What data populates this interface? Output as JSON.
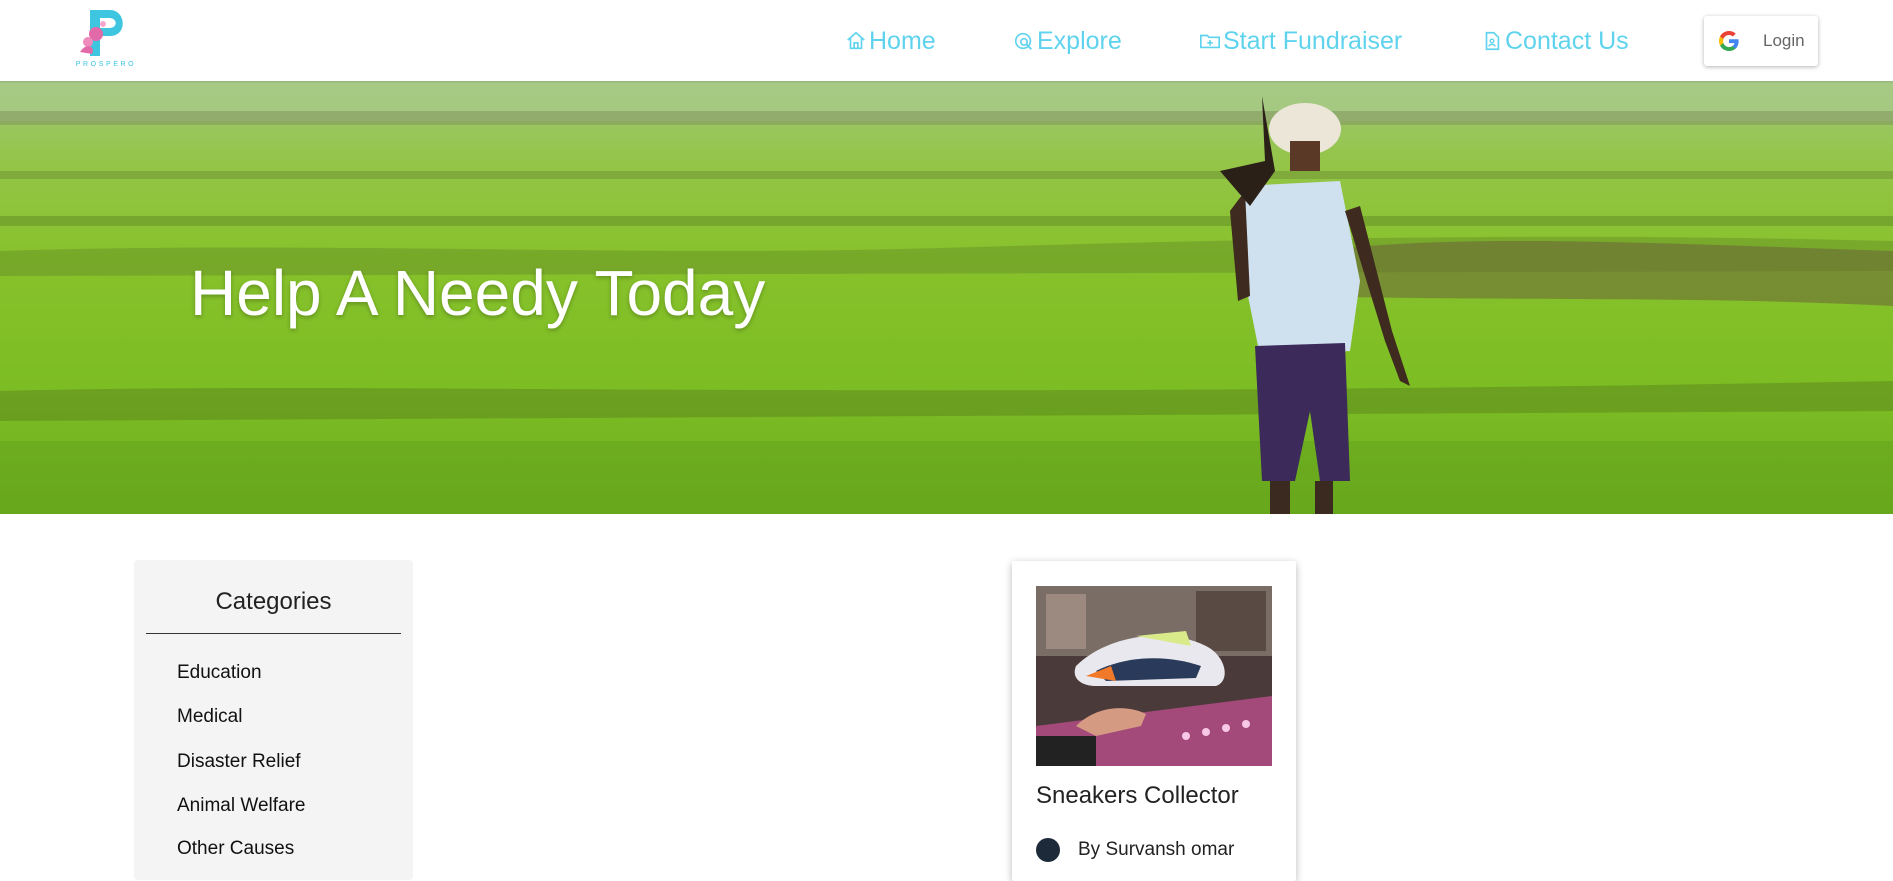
{
  "header": {
    "logo_text": "PROSPERO",
    "nav": [
      {
        "label": "Home",
        "icon": "home-icon"
      },
      {
        "label": "Explore",
        "icon": "explore-icon"
      },
      {
        "label": "Start Fundraiser",
        "icon": "folder-plus-icon"
      },
      {
        "label": "Contact Us",
        "icon": "document-icon"
      }
    ],
    "login_label": "Login",
    "nav_color": "#5fd3ee"
  },
  "hero": {
    "title": "Help A Needy Today"
  },
  "sidebar": {
    "title": "Categories",
    "items": [
      "Education",
      "Medical",
      "Disaster Relief",
      "Animal Welfare",
      "Other Causes"
    ]
  },
  "card": {
    "title": "Sneakers Collector",
    "author": "By Survansh omar"
  }
}
